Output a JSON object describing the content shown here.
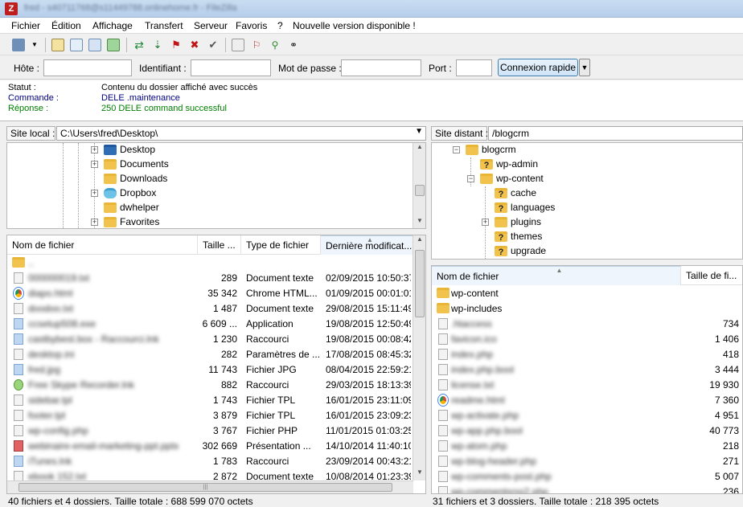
{
  "window": {
    "title": "fred - s40711768@s11449788.onlinehome.fr - FileZilla"
  },
  "menu": [
    "Fichier",
    "Édition",
    "Affichage",
    "Transfert",
    "Serveur",
    "Favoris",
    "?",
    "Nouvelle version disponible !"
  ],
  "toolbar_icons": [
    "site-manager-icon",
    "dropdown-arrow-icon",
    "toggle-log-icon",
    "toggle-local-tree-icon",
    "toggle-remote-tree-icon",
    "toggle-queue-icon",
    "refresh-icon",
    "process-queue-icon",
    "cancel-icon",
    "disconnect-icon",
    "reconnect-icon",
    "directory-listing-filter-icon",
    "compare-directories-icon",
    "sync-browsing-icon",
    "search-files-icon"
  ],
  "quickconnect": {
    "host_label": "Hôte :",
    "user_label": "Identifiant :",
    "password_label": "Mot de passe :",
    "port_label": "Port :",
    "button": "Connexion rapide",
    "host_value": "",
    "user_value": "",
    "password_value": "",
    "port_value": ""
  },
  "log": [
    {
      "label": "Statut :",
      "message": "Contenu du dossier affiché avec succès",
      "color": "#000000"
    },
    {
      "label": "Commande :",
      "message": "DELE .maintenance",
      "color": "#00007f"
    },
    {
      "label": "Réponse :",
      "message": "250 DELE command successful",
      "color": "#007f00"
    }
  ],
  "local": {
    "path_label": "Site local :",
    "path": "C:\\Users\\fred\\Desktop\\",
    "tree": [
      "Desktop",
      "Documents",
      "Downloads",
      "Dropbox",
      "dwhelper",
      "Favorites"
    ],
    "columns": [
      "Nom de fichier",
      "Taille ...",
      "Type de fichier",
      "Dernière modificat..."
    ],
    "parent_entry": "..",
    "files": [
      {
        "name": "000000019.txt",
        "size": "289",
        "type": "Document texte",
        "modified": "02/09/2015 10:50:37",
        "icon": "doc"
      },
      {
        "name": "diapo.html",
        "size": "35 342",
        "type": "Chrome HTML...",
        "modified": "01/09/2015 00:01:01",
        "icon": "chrome"
      },
      {
        "name": "doodoo.txt",
        "size": "1 487",
        "type": "Document texte",
        "modified": "29/08/2015 15:11:49",
        "icon": "doc"
      },
      {
        "name": "ccsetup508.exe",
        "size": "6 609 ...",
        "type": "Application",
        "modified": "19/08/2015 12:50:49",
        "icon": "blue"
      },
      {
        "name": "castbybest.box - Raccourci.lnk",
        "size": "1 230",
        "type": "Raccourci",
        "modified": "19/08/2015 00:08:42",
        "icon": "blue"
      },
      {
        "name": "desktop.ini",
        "size": "282",
        "type": "Paramètres de ...",
        "modified": "17/08/2015 08:45:32",
        "icon": "doc"
      },
      {
        "name": "fred.jpg",
        "size": "11 743",
        "type": "Fichier JPG",
        "modified": "08/04/2015 22:59:21",
        "icon": "blue"
      },
      {
        "name": "Free Skype Recorder.lnk",
        "size": "882",
        "type": "Raccourci",
        "modified": "29/03/2015 18:13:39",
        "icon": "green"
      },
      {
        "name": "sidebar.tpl",
        "size": "1 743",
        "type": "Fichier TPL",
        "modified": "16/01/2015 23:11:09",
        "icon": "doc"
      },
      {
        "name": "footer.tpl",
        "size": "3 879",
        "type": "Fichier TPL",
        "modified": "16/01/2015 23:09:23",
        "icon": "doc"
      },
      {
        "name": "wp-config.php",
        "size": "3 767",
        "type": "Fichier PHP",
        "modified": "11/01/2015 01:03:25",
        "icon": "doc"
      },
      {
        "name": "webinaire-email-marketing-ppt.pptx",
        "size": "302 669",
        "type": "Présentation ...",
        "modified": "14/10/2014 11:40:10",
        "icon": "red"
      },
      {
        "name": "iTunes.lnk",
        "size": "1 783",
        "type": "Raccourci",
        "modified": "23/09/2014 00:43:21",
        "icon": "blue"
      },
      {
        "name": "ebook 152.txt",
        "size": "2 872",
        "type": "Document texte",
        "modified": "10/08/2014 01:23:39",
        "icon": "doc"
      }
    ],
    "status": "40 fichiers et 4 dossiers. Taille totale : 688 599 070 octets"
  },
  "remote": {
    "path_label": "Site distant :",
    "path": "/blogcrm",
    "tree": [
      {
        "name": "blogcrm",
        "level": 0,
        "expander": "−",
        "unknown": false
      },
      {
        "name": "wp-admin",
        "level": 1,
        "expander": "",
        "unknown": true
      },
      {
        "name": "wp-content",
        "level": 1,
        "expander": "−",
        "unknown": false
      },
      {
        "name": "cache",
        "level": 2,
        "expander": "",
        "unknown": true
      },
      {
        "name": "languages",
        "level": 2,
        "expander": "",
        "unknown": true
      },
      {
        "name": "plugins",
        "level": 2,
        "expander": "+",
        "unknown": false
      },
      {
        "name": "themes",
        "level": 2,
        "expander": "",
        "unknown": true
      },
      {
        "name": "upgrade",
        "level": 2,
        "expander": "",
        "unknown": true
      }
    ],
    "columns": [
      "Nom de fichier",
      "Taille de fi..."
    ],
    "files": [
      {
        "name": "wp-content",
        "size": "",
        "icon": "folder",
        "blur": false
      },
      {
        "name": "wp-includes",
        "size": "",
        "icon": "folder",
        "blur": false
      },
      {
        "name": ".htaccess",
        "size": "734",
        "icon": "doc",
        "blur": true
      },
      {
        "name": "favicon.ico",
        "size": "1 406",
        "icon": "doc",
        "blur": true
      },
      {
        "name": "index.php",
        "size": "418",
        "icon": "doc",
        "blur": true
      },
      {
        "name": "index.php.bool",
        "size": "3 444",
        "icon": "doc",
        "blur": true
      },
      {
        "name": "license.txt",
        "size": "19 930",
        "icon": "doc",
        "blur": true
      },
      {
        "name": "readme.html",
        "size": "7 360",
        "icon": "chrome",
        "blur": true
      },
      {
        "name": "wp-activate.php",
        "size": "4 951",
        "icon": "doc",
        "blur": true
      },
      {
        "name": "wp-app.php.bool",
        "size": "40 773",
        "icon": "doc",
        "blur": true
      },
      {
        "name": "wp-atom.php",
        "size": "218",
        "icon": "doc",
        "blur": true
      },
      {
        "name": "wp-blog-header.php",
        "size": "271",
        "icon": "doc",
        "blur": true
      },
      {
        "name": "wp-comments-post.php",
        "size": "5 007",
        "icon": "doc",
        "blur": true
      },
      {
        "name": "wp-commentsrss2.php",
        "size": "236",
        "icon": "doc",
        "blur": true
      }
    ],
    "status": "31 fichiers et 3 dossiers. Taille totale : 218 395 octets"
  }
}
